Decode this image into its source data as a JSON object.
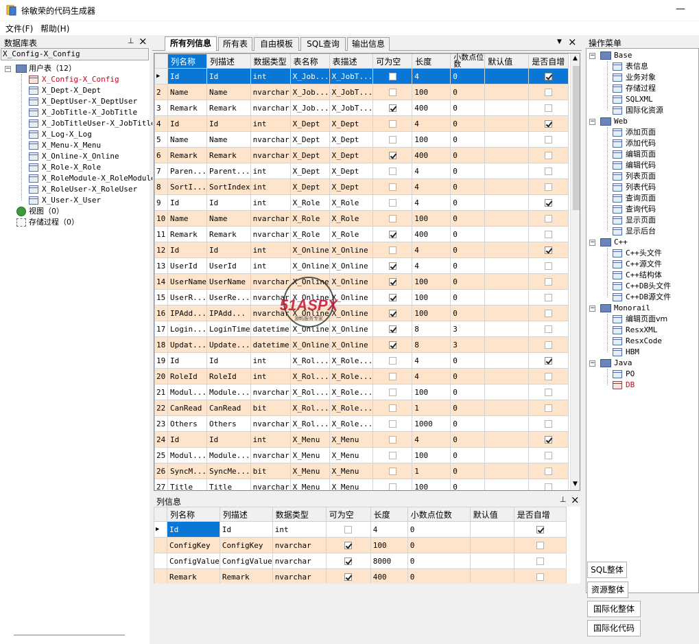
{
  "app": {
    "title": "徐敏荣的代码生成器"
  },
  "menu": [
    "文件(F)",
    "帮助(H)"
  ],
  "left": {
    "panel_title": "数据库表",
    "selected_label": "X_Config-X_Config",
    "root": "用户表（12）",
    "tables": [
      "X_Config-X_Config",
      "X_Dept-X_Dept",
      "X_DeptUser-X_DeptUser",
      "X_JobTitle-X_JobTitle",
      "X_JobTitleUser-X_JobTitleUser",
      "X_Log-X_Log",
      "X_Menu-X_Menu",
      "X_Online-X_Online",
      "X_Role-X_Role",
      "X_RoleModule-X_RoleModule",
      "X_RoleUser-X_RoleUser",
      "X_User-X_User"
    ],
    "views": "视图（0）",
    "procs": "存储过程（0）"
  },
  "tabs": [
    "所有列信息",
    "所有表",
    "自由模板",
    "SQL查询",
    "输出信息"
  ],
  "grid": {
    "headers": [
      "列名称",
      "列描述",
      "数据类型",
      "表名称",
      "表描述",
      "可为空",
      "长度",
      "小数点位数",
      "默认值",
      "是否自增"
    ],
    "rows": [
      [
        "1",
        "Id",
        "Id",
        "int",
        "X_Job...",
        "X_JobT...",
        false,
        "4",
        "0",
        "",
        true
      ],
      [
        "2",
        "Name",
        "Name",
        "nvarchar",
        "X_Job...",
        "X_JobT...",
        false,
        "100",
        "0",
        "",
        false
      ],
      [
        "3",
        "Remark",
        "Remark",
        "nvarchar",
        "X_Job...",
        "X_JobT...",
        true,
        "400",
        "0",
        "",
        false
      ],
      [
        "4",
        "Id",
        "Id",
        "int",
        "X_Dept",
        "X_Dept",
        false,
        "4",
        "0",
        "",
        true
      ],
      [
        "5",
        "Name",
        "Name",
        "nvarchar",
        "X_Dept",
        "X_Dept",
        false,
        "100",
        "0",
        "",
        false
      ],
      [
        "6",
        "Remark",
        "Remark",
        "nvarchar",
        "X_Dept",
        "X_Dept",
        true,
        "400",
        "0",
        "",
        false
      ],
      [
        "7",
        "Paren...",
        "Parent...",
        "int",
        "X_Dept",
        "X_Dept",
        false,
        "4",
        "0",
        "",
        false
      ],
      [
        "8",
        "SortI...",
        "SortIndex",
        "int",
        "X_Dept",
        "X_Dept",
        false,
        "4",
        "0",
        "",
        false
      ],
      [
        "9",
        "Id",
        "Id",
        "int",
        "X_Role",
        "X_Role",
        false,
        "4",
        "0",
        "",
        true
      ],
      [
        "10",
        "Name",
        "Name",
        "nvarchar",
        "X_Role",
        "X_Role",
        false,
        "100",
        "0",
        "",
        false
      ],
      [
        "11",
        "Remark",
        "Remark",
        "nvarchar",
        "X_Role",
        "X_Role",
        true,
        "400",
        "0",
        "",
        false
      ],
      [
        "12",
        "Id",
        "Id",
        "int",
        "X_Online",
        "X_Online",
        false,
        "4",
        "0",
        "",
        true
      ],
      [
        "13",
        "UserId",
        "UserId",
        "int",
        "X_Online",
        "X_Online",
        true,
        "4",
        "0",
        "",
        false
      ],
      [
        "14",
        "UserName",
        "UserName",
        "nvarchar",
        "X_Online",
        "X_Online",
        true,
        "100",
        "0",
        "",
        false
      ],
      [
        "15",
        "UserR...",
        "UserRe...",
        "nvarchar",
        "X_Online",
        "X_Online",
        true,
        "100",
        "0",
        "",
        false
      ],
      [
        "16",
        "IPAdd...",
        "IPAdd...",
        "nvarchar",
        "X_Online",
        "X_Online",
        true,
        "100",
        "0",
        "",
        false
      ],
      [
        "17",
        "Login...",
        "LoginTime",
        "datetime",
        "X_Online",
        "X_Online",
        true,
        "8",
        "3",
        "",
        false
      ],
      [
        "18",
        "Updat...",
        "Update...",
        "datetime",
        "X_Online",
        "X_Online",
        true,
        "8",
        "3",
        "",
        false
      ],
      [
        "19",
        "Id",
        "Id",
        "int",
        "X_Rol...",
        "X_Role...",
        false,
        "4",
        "0",
        "",
        true
      ],
      [
        "20",
        "RoleId",
        "RoleId",
        "int",
        "X_Rol...",
        "X_Role...",
        false,
        "4",
        "0",
        "",
        false
      ],
      [
        "21",
        "Modul...",
        "Module...",
        "nvarchar",
        "X_Rol...",
        "X_Role...",
        false,
        "100",
        "0",
        "",
        false
      ],
      [
        "22",
        "CanRead",
        "CanRead",
        "bit",
        "X_Rol...",
        "X_Role...",
        false,
        "1",
        "0",
        "",
        false
      ],
      [
        "23",
        "Others",
        "Others",
        "nvarchar",
        "X_Rol...",
        "X_Role...",
        false,
        "1000",
        "0",
        "",
        false
      ],
      [
        "24",
        "Id",
        "Id",
        "int",
        "X_Menu",
        "X_Menu",
        false,
        "4",
        "0",
        "",
        true
      ],
      [
        "25",
        "Modul...",
        "Module...",
        "nvarchar",
        "X_Menu",
        "X_Menu",
        false,
        "100",
        "0",
        "",
        false
      ],
      [
        "26",
        "SyncM...",
        "SyncMe...",
        "bit",
        "X_Menu",
        "X_Menu",
        false,
        "1",
        "0",
        "",
        false
      ],
      [
        "27",
        "Title",
        "Title",
        "nvarchar",
        "X_Menu",
        "X_Menu",
        false,
        "100",
        "0",
        "",
        false
      ]
    ]
  },
  "bottom": {
    "panel_title": "列信息",
    "headers": [
      "列名称",
      "列描述",
      "数据类型",
      "可为空",
      "长度",
      "小数点位数",
      "默认值",
      "是否自增"
    ],
    "rows": [
      [
        "Id",
        "Id",
        "int",
        false,
        "4",
        "0",
        "",
        true
      ],
      [
        "ConfigKey",
        "ConfigKey",
        "nvarchar",
        true,
        "100",
        "0",
        "",
        false
      ],
      [
        "ConfigValue",
        "ConfigValue",
        "nvarchar",
        true,
        "8000",
        "0",
        "",
        false
      ],
      [
        "Remark",
        "Remark",
        "nvarchar",
        true,
        "400",
        "0",
        "",
        false
      ]
    ]
  },
  "right": {
    "panel_title": "操作菜单",
    "groups": [
      {
        "name": "Base",
        "items": [
          "表信息",
          "业务对象",
          "存储过程",
          "SQLXML",
          "国际化资源"
        ]
      },
      {
        "name": "Web",
        "items": [
          "添加页面",
          "添加代码",
          "编辑页面",
          "编辑代码",
          "列表页面",
          "列表代码",
          "查询页面",
          "查询代码",
          "显示页面",
          "显示后台"
        ]
      },
      {
        "name": "C++",
        "items": [
          "C++头文件",
          "C++源文件",
          "C++结构体",
          "C++DB头文件",
          "C++DB源文件"
        ]
      },
      {
        "name": "Monorail",
        "items": [
          "编辑页面vm",
          "ResxXML",
          "ResxCode",
          "HBM"
        ]
      },
      {
        "name": "Java",
        "items": [
          "PO",
          "DB"
        ]
      }
    ],
    "buttons": [
      "SQL整体",
      "资源整体",
      "国际化整体",
      "国际化代码"
    ]
  },
  "watermark": {
    "big": "51ASPX",
    "small": "源码服务专家"
  }
}
